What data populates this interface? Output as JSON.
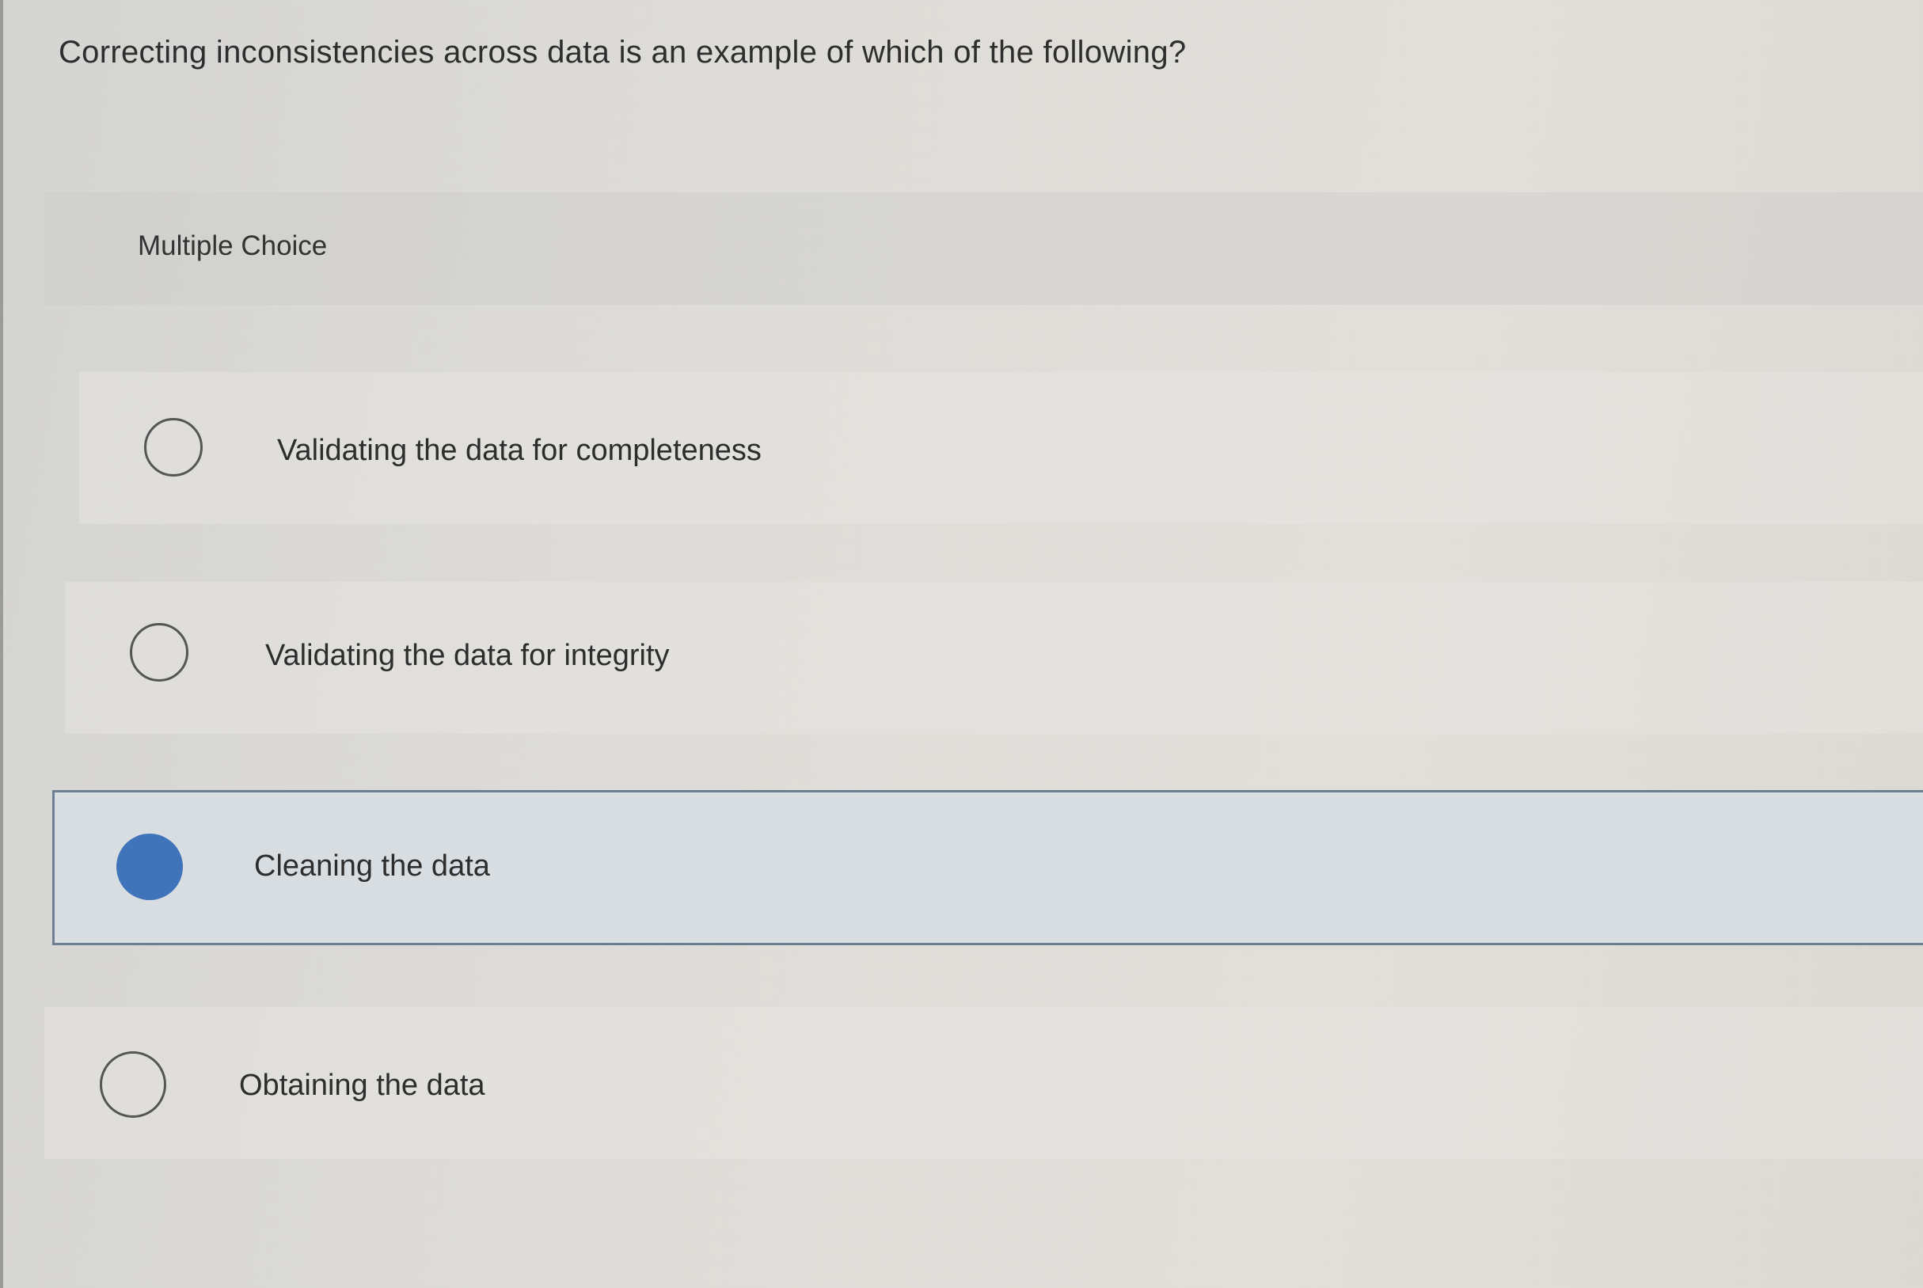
{
  "question": {
    "text": "Correcting inconsistencies across data is an example of which of the following?"
  },
  "quiz": {
    "type_label": "Multiple Choice",
    "options": [
      {
        "label": "Validating the data for completeness",
        "selected": false
      },
      {
        "label": "Validating the data for integrity",
        "selected": false
      },
      {
        "label": "Cleaning the data",
        "selected": true
      },
      {
        "label": "Obtaining the data",
        "selected": false
      }
    ]
  },
  "colors": {
    "selected_radio": "#3f73ba",
    "selected_row_border": "#6f7f92",
    "selected_row_background": "#d8dde2"
  }
}
